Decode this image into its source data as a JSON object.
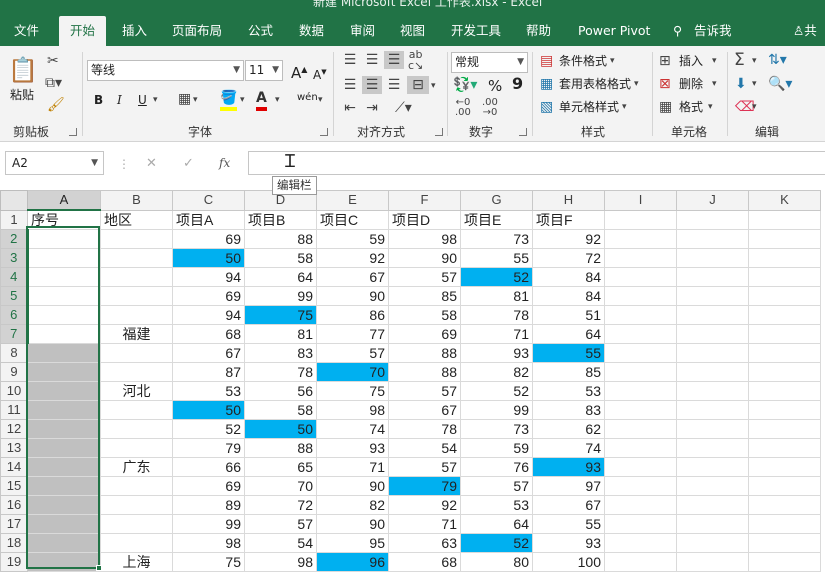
{
  "window": {
    "title": "新建 Microsoft Excel 工作表.xlsx  -  Excel"
  },
  "tabs": [
    "文件",
    "开始",
    "插入",
    "页面布局",
    "公式",
    "数据",
    "审阅",
    "视图",
    "开发工具",
    "帮助",
    "Power Pivot"
  ],
  "tell_me": "告诉我",
  "share": "共",
  "ribbon": {
    "clipboard": {
      "paste": "粘贴",
      "label": "剪贴板"
    },
    "font": {
      "name": "等线",
      "size": "11",
      "label": "字体",
      "bold": "B",
      "italic": "I",
      "underline": "U",
      "grow": "A",
      "shrink": "A",
      "phonetic": "wén"
    },
    "alignment": {
      "label": "对齐方式"
    },
    "number": {
      "format": "常规",
      "label": "数字",
      "percent": "%",
      "comma": "9"
    },
    "styles": {
      "conditional": "条件格式",
      "table_format": "套用表格格式",
      "cell_styles": "单元格样式",
      "label": "样式"
    },
    "cells": {
      "insert": "插入",
      "delete": "删除",
      "format": "格式",
      "label": "单元格"
    },
    "editing": {
      "label": "编辑"
    }
  },
  "formula_bar": {
    "name_box": "A2",
    "cancel": "✕",
    "enter": "✓",
    "fx": "fx",
    "value": "",
    "tooltip": "编辑栏"
  },
  "sheet": {
    "columns": [
      "A",
      "B",
      "C",
      "D",
      "E",
      "F",
      "G",
      "H",
      "I",
      "J",
      "K"
    ],
    "headers": [
      "序号",
      "地区",
      "项目A",
      "项目B",
      "项目C",
      "项目D",
      "项目E",
      "项目F"
    ],
    "regions": {
      "7": "福建",
      "10": "河北",
      "14": "广东",
      "19": "上海"
    },
    "rows": [
      [
        69,
        88,
        59,
        98,
        73,
        92
      ],
      [
        50,
        58,
        92,
        90,
        55,
        72
      ],
      [
        94,
        64,
        67,
        57,
        52,
        84
      ],
      [
        69,
        99,
        90,
        85,
        81,
        84
      ],
      [
        94,
        75,
        86,
        58,
        78,
        51
      ],
      [
        68,
        81,
        77,
        69,
        71,
        64
      ],
      [
        67,
        83,
        57,
        88,
        93,
        55
      ],
      [
        87,
        78,
        70,
        88,
        82,
        85
      ],
      [
        53,
        56,
        75,
        57,
        52,
        53
      ],
      [
        50,
        58,
        98,
        67,
        99,
        83
      ],
      [
        52,
        50,
        74,
        78,
        73,
        62
      ],
      [
        79,
        88,
        93,
        54,
        59,
        74
      ],
      [
        66,
        65,
        71,
        57,
        76,
        93
      ],
      [
        69,
        70,
        90,
        79,
        57,
        97
      ],
      [
        89,
        72,
        82,
        92,
        53,
        67
      ],
      [
        99,
        57,
        90,
        71,
        64,
        55
      ],
      [
        98,
        54,
        95,
        63,
        52,
        93
      ],
      [
        75,
        98,
        96,
        68,
        80,
        100
      ]
    ],
    "highlighted": [
      [
        3,
        0
      ],
      [
        6,
        1
      ],
      [
        4,
        4
      ],
      [
        8,
        5
      ],
      [
        9,
        2
      ],
      [
        11,
        0
      ],
      [
        12,
        1
      ],
      [
        14,
        5
      ],
      [
        15,
        3
      ],
      [
        18,
        4
      ],
      [
        19,
        2
      ]
    ],
    "gray_rows": [
      8,
      9,
      10,
      11,
      12,
      13,
      14,
      15,
      16,
      17,
      18,
      19
    ],
    "highlight_color": "#00b0f0",
    "accent_color": "#217346"
  }
}
